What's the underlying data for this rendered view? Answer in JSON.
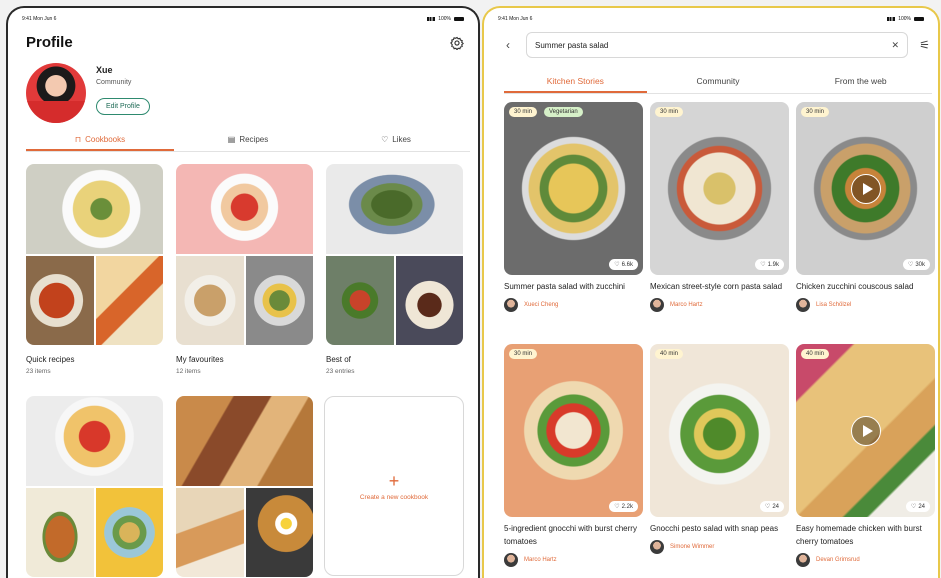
{
  "left": {
    "status": {
      "time": "9:41 Mon Jun 6",
      "battery": "100%"
    },
    "title": "Profile",
    "user": {
      "name": "Xue",
      "role": "Community",
      "edit_label": "Edit Profile"
    },
    "tabs": [
      {
        "label": "Cookbooks",
        "icon": "bookmark-icon",
        "active": true
      },
      {
        "label": "Recipes",
        "icon": "recipe-icon",
        "active": false
      },
      {
        "label": "Likes",
        "icon": "heart-icon",
        "active": false
      }
    ],
    "cookbooks": [
      {
        "title": "Quick recipes",
        "count": "23 items"
      },
      {
        "title": "My favourites",
        "count": "12 items"
      },
      {
        "title": "Best of",
        "count": "23 entries"
      }
    ],
    "new_cookbook_label": "Create a new cookbook"
  },
  "right": {
    "status": {
      "time": "9:41 Mon Jun 6",
      "battery": "100%"
    },
    "search": {
      "value": "Summer pasta salad"
    },
    "tabs": [
      {
        "label": "Kitchen Stories",
        "active": true
      },
      {
        "label": "Community",
        "active": false
      },
      {
        "label": "From the web",
        "active": false
      }
    ],
    "results": [
      {
        "time": "30 min",
        "tag": "Vegetarian",
        "likes": "6.6k",
        "title": "Summer pasta salad with zucchini",
        "author": "Xueci Cheng",
        "video": false
      },
      {
        "time": "30 min",
        "tag": "",
        "likes": "1.9k",
        "title": "Mexican street-style corn pasta salad",
        "author": "Marco Hartz",
        "video": false
      },
      {
        "time": "30 min",
        "tag": "",
        "likes": "30k",
        "title": "Chicken zucchini couscous salad",
        "author": "Lisa Schölzel",
        "video": true
      },
      {
        "time": "30 min",
        "tag": "",
        "likes": "2.2k",
        "title": "5-ingredient gnocchi with burst cherry tomatoes",
        "author": "Marco Hartz",
        "video": false
      },
      {
        "time": "40 min",
        "tag": "",
        "likes": "24",
        "title": "Gnocchi pesto salad with snap peas",
        "author": "Simone Wimmer",
        "video": false
      },
      {
        "time": "40 min",
        "tag": "",
        "likes": "24",
        "title": "Easy homemade chicken with burst cherry tomatoes",
        "author": "Devan Grimsrud",
        "video": true
      }
    ]
  },
  "colors": {
    "accent": "#e06a3a",
    "edit_border": "#2e8a6f"
  }
}
